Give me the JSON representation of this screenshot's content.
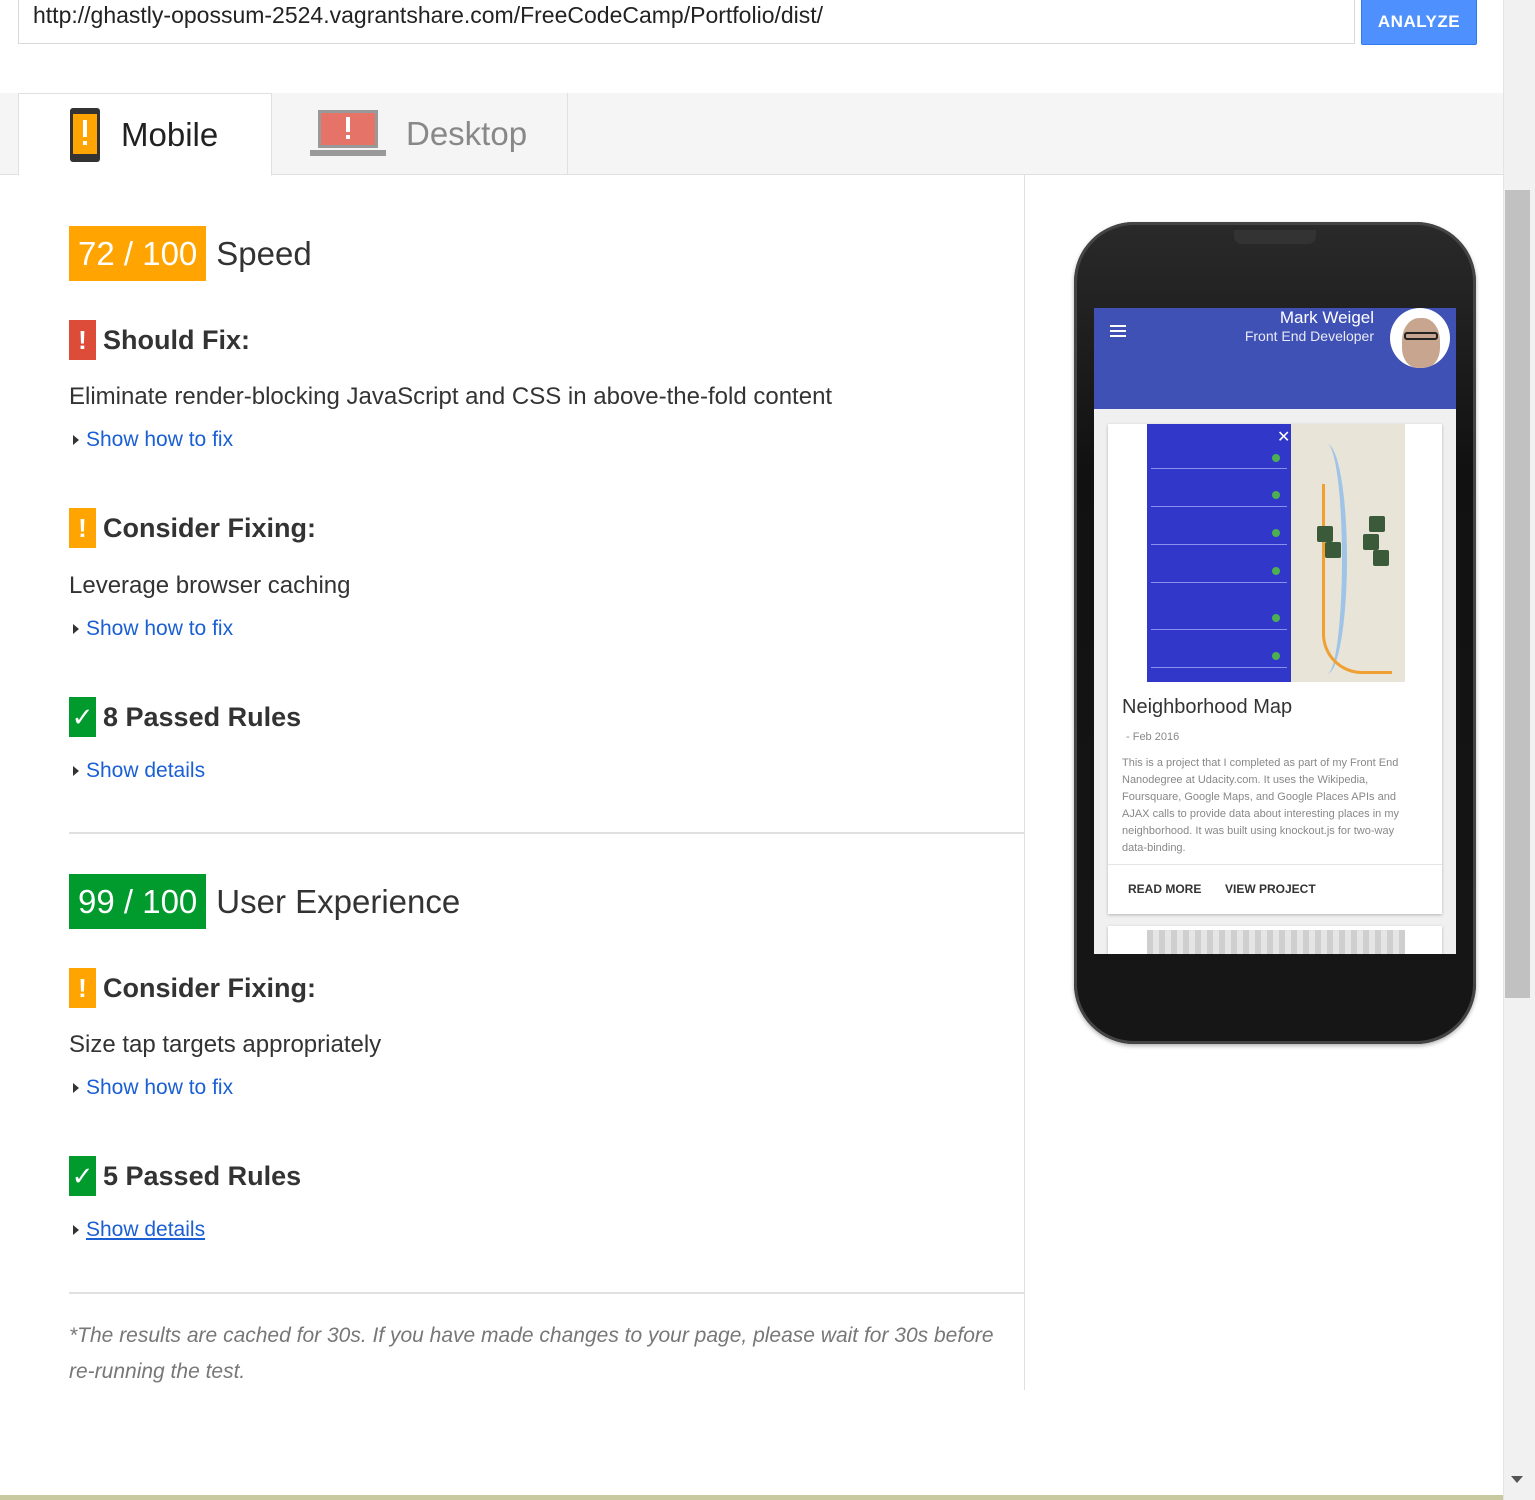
{
  "url_bar": {
    "value": "http://ghastly-opossum-2524.vagrantshare.com/FreeCodeCamp/Portfolio/dist/",
    "analyze_label": "ANALYZE"
  },
  "tabs": [
    {
      "label": "Mobile",
      "icon": "mobile-warning-icon",
      "active": true
    },
    {
      "label": "Desktop",
      "icon": "desktop-warning-icon",
      "active": false
    }
  ],
  "speed": {
    "score": "72 / 100",
    "title": "Speed",
    "should_fix": {
      "title": "Should Fix:",
      "items": [
        "Eliminate render-blocking JavaScript and CSS in above-the-fold content"
      ],
      "link": "Show how to fix"
    },
    "consider_fixing": {
      "title": "Consider Fixing:",
      "items": [
        "Leverage browser caching"
      ],
      "link": "Show how to fix"
    },
    "passed": {
      "title": "8 Passed Rules",
      "link": "Show details"
    }
  },
  "ux": {
    "score": "99 / 100",
    "title": "User Experience",
    "consider_fixing": {
      "title": "Consider Fixing:",
      "items": [
        "Size tap targets appropriately"
      ],
      "link": "Show how to fix"
    },
    "passed": {
      "title": "5 Passed Rules",
      "link": "Show details"
    }
  },
  "footnote": "*The results are cached for 30s. If you have made changes to your page, please wait for 30s before re-running the test.",
  "preview": {
    "name": "Mark Weigel",
    "role": "Front End Developer",
    "card_title": "Neighborhood Map",
    "card_date": "- Feb 2016",
    "card_text": "This is a project that I completed as part of my Front End Nanodegree at Udacity.com. It uses the Wikipedia, Foursquare, Google Maps, and Google Places APIs and AJAX calls to provide data about interesting places in my neighborhood. It was built using knockout.js for two-way data-binding.",
    "read_more": "READ MORE",
    "view_project": "VIEW PROJECT"
  },
  "icons": {
    "warning_bang": "!",
    "check": "✓"
  },
  "colors": {
    "should_fix": "#dd4b39",
    "consider": "#ffa400",
    "passed": "#009a2d",
    "link": "#1a5fd4",
    "analyze_button": "#4d90fe",
    "preview_header": "#3f51b5"
  }
}
